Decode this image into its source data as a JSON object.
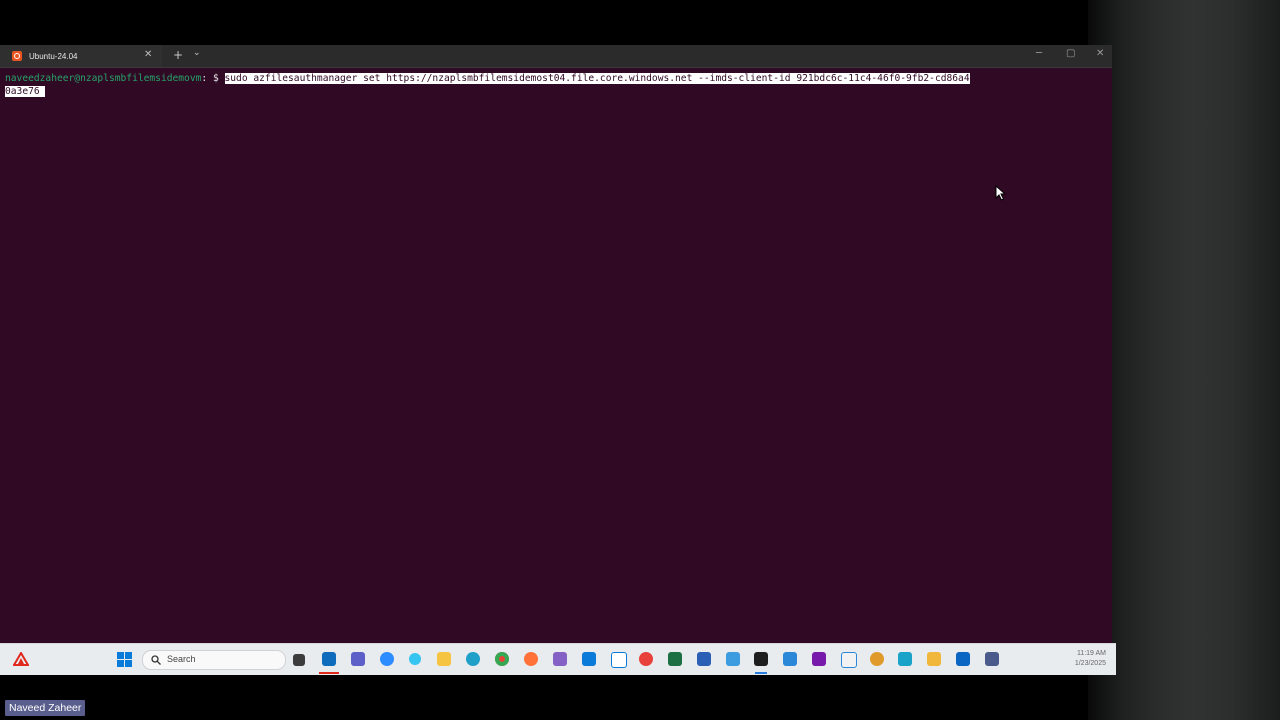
{
  "window": {
    "tab_title": "Ubuntu-24.04",
    "tab_close": "✕",
    "new_tab": "+",
    "tab_menu": "⌄",
    "minimize": "─",
    "maximize": "▢",
    "close": "✕"
  },
  "terminal": {
    "prompt_user_host": "naveedzaheer@nzaplsmbfilemsidemovm",
    "prompt_suffix": ": $ ",
    "command_line1": "sudo azfilesauthmanager set https://nzaplsmbfilemsidemost04.file.core.windows.net --imds-client-id 921bdc6c-11c4-46f0-9fb2-cd86a4",
    "command_line2": "0a3e76 "
  },
  "taskbar": {
    "search_placeholder": "Search",
    "clock_time": "11:19 AM",
    "clock_date": "1/23/2025",
    "pinned_icons": [
      "adobe-icon",
      "windows-start-icon",
      "task-view-icon",
      "outlook-icon",
      "teams-icon",
      "zoom-icon",
      "slack-icon",
      "file-explorer-icon",
      "edge-icon",
      "chrome-icon",
      "firefox-icon",
      "visual-studio-icon",
      "vscode-icon",
      "app-window-icon",
      "app-red-icon",
      "excel-icon",
      "word-icon",
      "notepad-icon",
      "terminal-icon",
      "app-blue-icon",
      "onenote-icon",
      "snipping-tool-icon",
      "app-orange-icon",
      "app-cyan-icon",
      "app-folder-icon",
      "remote-desktop-icon",
      "app-settings-icon"
    ]
  },
  "presenter": {
    "name": "Naveed Zaheer"
  },
  "colors": {
    "terminal_bg": "#300a24",
    "prompt_green": "#26a269",
    "taskbar_bg": "#e8ecef"
  }
}
